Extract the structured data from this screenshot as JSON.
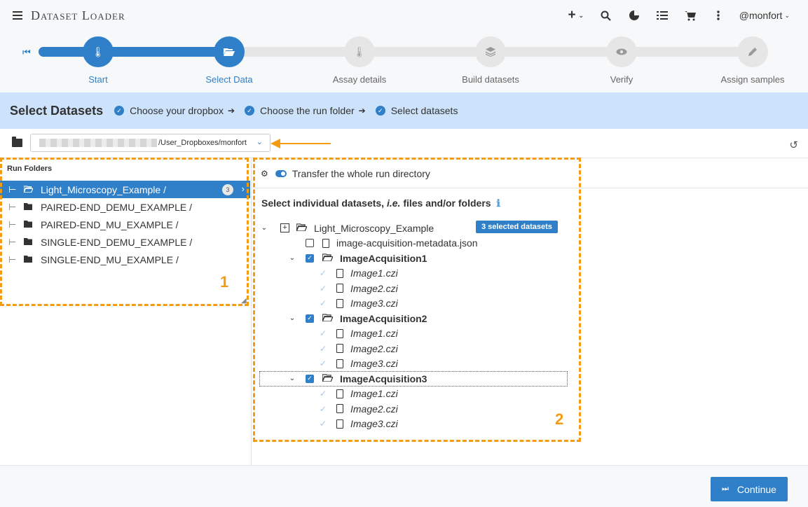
{
  "app": {
    "title": "Dataset Loader",
    "user": "@monfort"
  },
  "steps": [
    {
      "label": "Start",
      "icon": "thermometer-icon",
      "active": true
    },
    {
      "label": "Select Data",
      "icon": "folder-open-icon",
      "active": true
    },
    {
      "label": "Assay details",
      "icon": "thermometer-icon",
      "active": false
    },
    {
      "label": "Build datasets",
      "icon": "layers-icon",
      "active": false
    },
    {
      "label": "Verify",
      "icon": "eye-icon",
      "active": false
    },
    {
      "label": "Assign samples",
      "icon": "pencil-icon",
      "active": false
    }
  ],
  "select_bar": {
    "title": "Select Datasets",
    "crumbs": [
      "Choose your dropbox",
      "Choose the run folder",
      "Select datasets"
    ]
  },
  "path": {
    "value": "/User_Dropboxes/monfort"
  },
  "run_folders": {
    "title": "Run Folders",
    "items": [
      {
        "label": "Light_Microscopy_Example /",
        "count": "3",
        "selected": true
      },
      {
        "label": "PAIRED-END_DEMU_EXAMPLE /"
      },
      {
        "label": "PAIRED-END_MU_EXAMPLE /"
      },
      {
        "label": "SINGLE-END_DEMU_EXAMPLE /"
      },
      {
        "label": "SINGLE-END_MU_EXAMPLE /"
      }
    ]
  },
  "right": {
    "transfer_label": "Transfer the whole run directory",
    "select_title_a": "Select individual datasets,",
    "select_title_b": "i.e.",
    "select_title_c": "files and/or folders",
    "root": "Light_Microscopy_Example",
    "selected_badge": "3 selected datasets",
    "metadata_file": "image-acquisition-metadata.json",
    "acquisitions": [
      {
        "name": "ImageAcquisition1",
        "files": [
          "Image1.czi",
          "Image2.czi",
          "Image3.czi"
        ]
      },
      {
        "name": "ImageAcquisition2",
        "files": [
          "Image1.czi",
          "Image2.czi",
          "Image3.czi"
        ]
      },
      {
        "name": "ImageAcquisition3",
        "files": [
          "Image1.czi",
          "Image2.czi",
          "Image3.czi"
        ]
      }
    ]
  },
  "annotations": {
    "box1": "1",
    "box2": "2"
  },
  "footer": {
    "continue": "Continue"
  },
  "colors": {
    "accent": "#2f80c8",
    "annotation": "#f39c12",
    "select_bar": "#cde2fb"
  }
}
